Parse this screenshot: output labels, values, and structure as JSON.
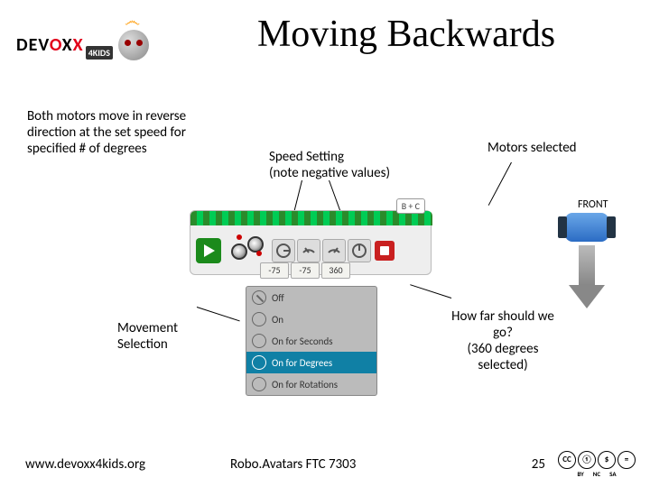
{
  "logo": {
    "name": "DEVOXX",
    "sub": "4KIDS"
  },
  "title": "Moving Backwards",
  "captions": {
    "main": "Both motors move in reverse direction at the set speed for specified # of degrees",
    "speed": "Speed Setting\n(note negative values)",
    "motors": "Motors selected",
    "movement": "Movement Selection",
    "howfar": "How far should we go?\n(360 degrees selected)",
    "front": "FRONT"
  },
  "block": {
    "ports": "B + C",
    "values": [
      "-75",
      "-75",
      "360"
    ],
    "dropdown": {
      "items": [
        "Off",
        "On",
        "On for Seconds",
        "On for Degrees",
        "On for Rotations"
      ],
      "selected": 3
    }
  },
  "footer": {
    "url": "www.devoxx4kids.org",
    "team": "Robo.Avatars FTC 7303",
    "page": "25",
    "cc": [
      "CC",
      "①",
      "$",
      "="
    ],
    "cc_labels": [
      "BY",
      "NC",
      "SA"
    ]
  }
}
